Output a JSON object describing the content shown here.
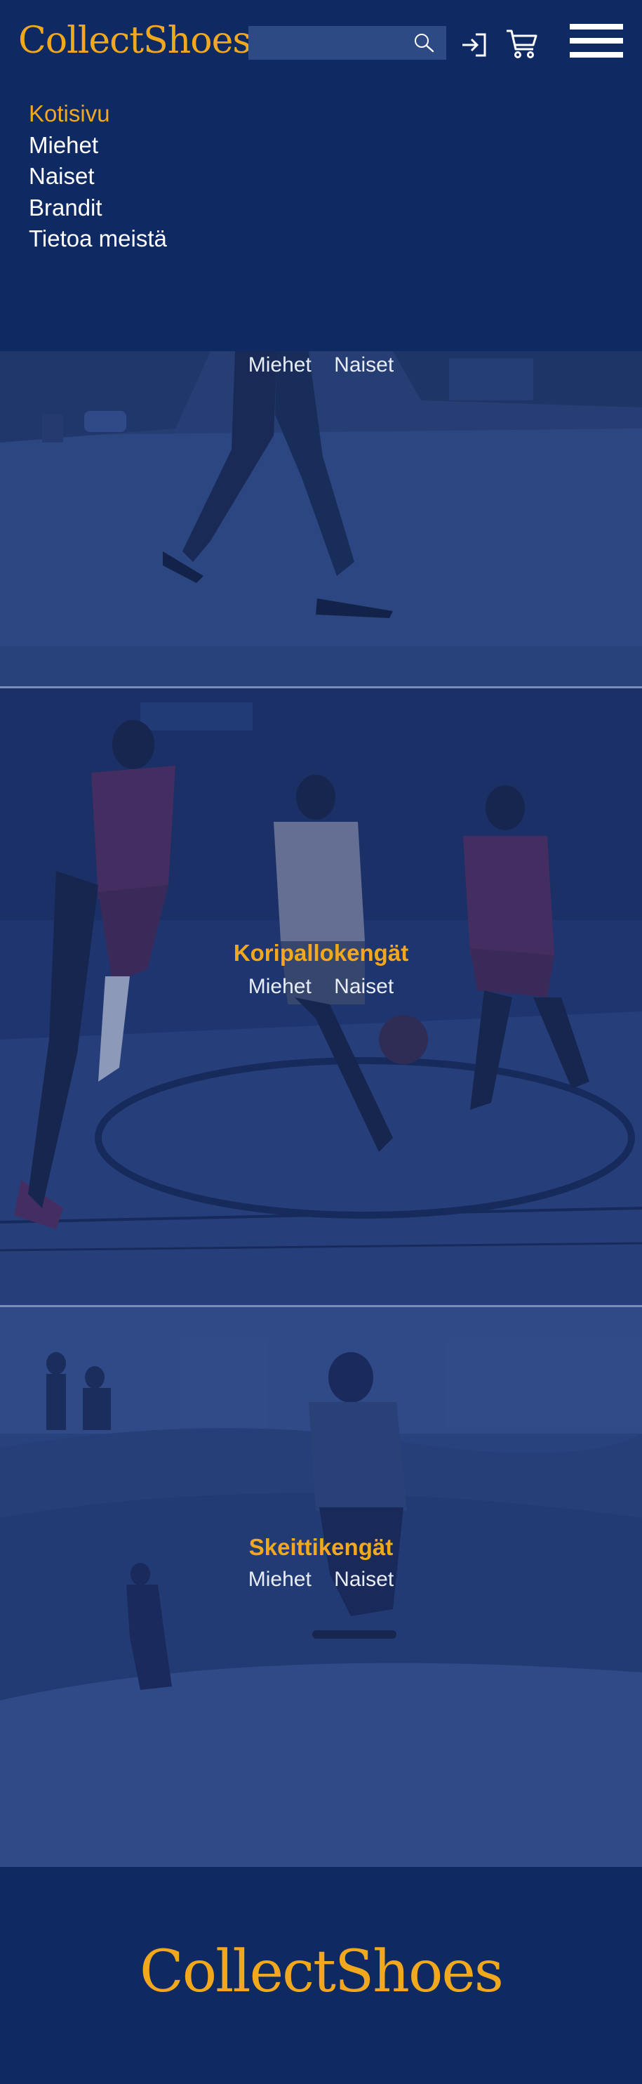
{
  "header": {
    "logo": "CollectShoes",
    "search": {
      "placeholder": "",
      "value": ""
    },
    "icons": [
      "search-icon",
      "login-icon",
      "cart-icon",
      "hamburger-menu-icon"
    ]
  },
  "nav": {
    "items": [
      {
        "label": "Kotisivu",
        "active": true
      },
      {
        "label": "Miehet",
        "active": false
      },
      {
        "label": "Naiset",
        "active": false
      },
      {
        "label": "Brandit",
        "active": false
      },
      {
        "label": "Tietoa meistä",
        "active": false
      }
    ]
  },
  "sections": [
    {
      "title": "",
      "links": [
        "Miehet",
        "Naiset"
      ]
    },
    {
      "title": "Koripallokengät",
      "links": [
        "Miehet",
        "Naiset"
      ]
    },
    {
      "title": "Skeittikengät",
      "links": [
        "Miehet",
        "Naiset"
      ]
    }
  ],
  "footer": {
    "logo": "CollectShoes"
  },
  "colors": {
    "background": "#0f2a63",
    "accent": "#f2a81d",
    "search_box": "#2e4a85",
    "text": "#ffffff"
  }
}
